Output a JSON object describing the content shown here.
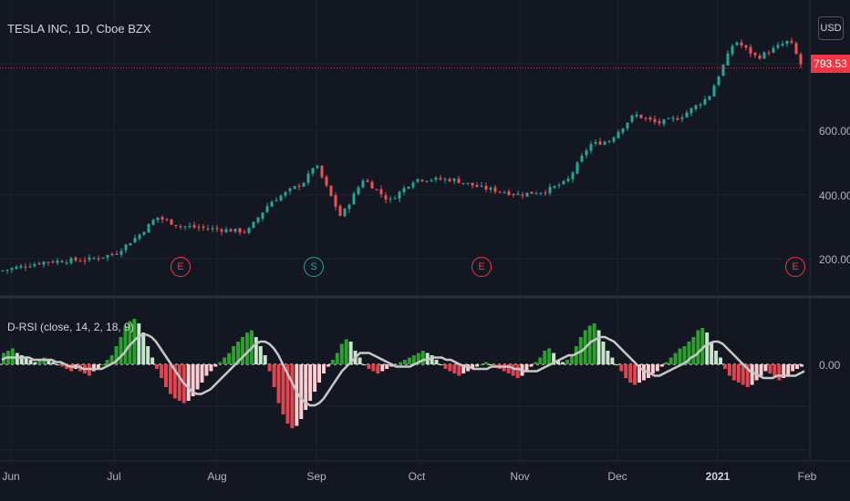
{
  "symbol_label": "TESLA INC, 1D, Cboe BZX",
  "currency_button": "USD",
  "last_price": "793.53",
  "price_axis_ticks": [
    "600.00",
    "400.00",
    "200.00"
  ],
  "indicator_label": "D-RSI (close, 14, 2, 18, 9)",
  "indicator_zero_label": "0.00",
  "time_axis_ticks": [
    "Jun",
    "Jul",
    "Aug",
    "Sep",
    "Oct",
    "Nov",
    "Dec",
    "2021",
    "Feb"
  ],
  "events": [
    {
      "letter": "E",
      "kind": "earnings"
    },
    {
      "letter": "S",
      "kind": "split"
    },
    {
      "letter": "E",
      "kind": "earnings"
    },
    {
      "letter": "E",
      "kind": "earnings"
    }
  ],
  "colors": {
    "background": "#131722",
    "up": "#26a69a",
    "down": "#ef5350",
    "hist_up_strong": "#2ca02c",
    "hist_up_weak": "#c8e6c9",
    "hist_down_strong": "#e0464f",
    "hist_down_weak": "#ffcdd2",
    "signal": "#c8c8c8",
    "price_line": "#f23645",
    "event_e": "#f23645",
    "event_s": "#26a69a"
  },
  "chart_data": [
    {
      "type": "candlestick",
      "title": "TESLA INC, 1D, Cboe BZX",
      "y_ticks": [
        200,
        400,
        600
      ],
      "last_price": 793.53,
      "close_points": [
        [
          "2020-05-26",
          163
        ],
        [
          "2020-06-08",
          190
        ],
        [
          "2020-06-22",
          198
        ],
        [
          "2020-06-30",
          215
        ],
        [
          "2020-07-08",
          278
        ],
        [
          "2020-07-13",
          330
        ],
        [
          "2020-07-20",
          302
        ],
        [
          "2020-07-27",
          296
        ],
        [
          "2020-08-10",
          284
        ],
        [
          "2020-08-17",
          375
        ],
        [
          "2020-08-28",
          442
        ],
        [
          "2020-08-31",
          498
        ],
        [
          "2020-09-08",
          330
        ],
        [
          "2020-09-15",
          449
        ],
        [
          "2020-09-23",
          380
        ],
        [
          "2020-10-01",
          448
        ],
        [
          "2020-10-13",
          446
        ],
        [
          "2020-10-21",
          422
        ],
        [
          "2020-11-02",
          400
        ],
        [
          "2020-11-10",
          410
        ],
        [
          "2020-11-17",
          440
        ],
        [
          "2020-11-24",
          555
        ],
        [
          "2020-11-30",
          567
        ],
        [
          "2020-12-08",
          649
        ],
        [
          "2020-12-15",
          622
        ],
        [
          "2020-12-22",
          640
        ],
        [
          "2020-12-31",
          705
        ],
        [
          "2021-01-08",
          880
        ],
        [
          "2021-01-15",
          826
        ],
        [
          "2021-01-25",
          880
        ],
        [
          "2021-01-29",
          793.53
        ]
      ]
    },
    {
      "type": "bar",
      "title": "D-RSI (close, 14, 2, 18, 9)",
      "y_ticks": [
        0
      ],
      "histogram": [
        5,
        6,
        7,
        5,
        4,
        3,
        2,
        1,
        2,
        3,
        2,
        1,
        0,
        -1,
        -2,
        -3,
        -2,
        -3,
        -4,
        -5,
        -3,
        -2,
        0,
        2,
        4,
        8,
        12,
        17,
        19,
        20,
        18,
        14,
        8,
        3,
        -2,
        -6,
        -10,
        -13,
        -15,
        -16,
        -17,
        -16,
        -14,
        -11,
        -8,
        -5,
        -3,
        -1,
        1,
        3,
        5,
        8,
        10,
        12,
        14,
        15,
        12,
        8,
        4,
        -3,
        -10,
        -17,
        -22,
        -26,
        -28,
        -27,
        -24,
        -20,
        -16,
        -12,
        -8,
        -4,
        -1,
        2,
        5,
        9,
        11,
        10,
        6,
        3,
        0,
        -2,
        -3,
        -4,
        -3,
        -2,
        -1,
        0,
        1,
        2,
        3,
        4,
        5,
        6,
        5,
        4,
        2,
        0,
        -2,
        -3,
        -4,
        -5,
        -4,
        -3,
        -2,
        -1,
        0,
        1,
        0,
        -1,
        -2,
        -3,
        -4,
        -5,
        -6,
        -5,
        -3,
        -1,
        1,
        3,
        6,
        7,
        5,
        2,
        1,
        2,
        4,
        8,
        12,
        15,
        17,
        18,
        15,
        10,
        6,
        3,
        0,
        -3,
        -6,
        -8,
        -9,
        -8,
        -7,
        -6,
        -4,
        -3,
        -1,
        1,
        3,
        5,
        7,
        8,
        10,
        12,
        15,
        16,
        14,
        10,
        6,
        3,
        -2,
        -5,
        -7,
        -8,
        -9,
        -10,
        -9,
        -7,
        -5,
        -3,
        -4,
        -6,
        -7,
        -6,
        -5,
        -3,
        -2,
        -1
      ],
      "signal": [
        2,
        3,
        3,
        3,
        3,
        3,
        3,
        2,
        2,
        2,
        2,
        2,
        1,
        1,
        0,
        -1,
        -1,
        -1,
        -2,
        -2,
        -2,
        -2,
        -2,
        -1,
        0,
        1,
        3,
        5,
        8,
        10,
        12,
        13,
        13,
        12,
        10,
        7,
        4,
        1,
        -2,
        -5,
        -8,
        -10,
        -12,
        -13,
        -13,
        -12,
        -11,
        -9,
        -7,
        -5,
        -3,
        -1,
        1,
        3,
        5,
        7,
        9,
        10,
        10,
        9,
        7,
        4,
        0,
        -4,
        -8,
        -12,
        -15,
        -17,
        -18,
        -18,
        -17,
        -15,
        -12,
        -9,
        -6,
        -3,
        -1,
        1,
        3,
        5,
        5,
        5,
        4,
        3,
        2,
        1,
        0,
        -1,
        -1,
        -1,
        -1,
        0,
        1,
        2,
        2,
        3,
        3,
        3,
        2,
        2,
        1,
        0,
        -1,
        -1,
        -2,
        -2,
        -2,
        -2,
        -1,
        -1,
        -1,
        -1,
        -1,
        -2,
        -2,
        -3,
        -3,
        -3,
        -3,
        -2,
        -1,
        0,
        1,
        2,
        3,
        4,
        4,
        5,
        6,
        8,
        10,
        11,
        12,
        12,
        11,
        10,
        8,
        6,
        4,
        2,
        0,
        -2,
        -3,
        -4,
        -5,
        -5,
        -4,
        -3,
        -2,
        -1,
        0,
        1,
        3,
        4,
        6,
        8,
        9,
        10,
        10,
        9,
        7,
        5,
        3,
        1,
        -1,
        -3,
        -4,
        -5,
        -6,
        -6,
        -6,
        -5,
        -5,
        -5,
        -5,
        -5,
        -4,
        -3
      ]
    }
  ]
}
